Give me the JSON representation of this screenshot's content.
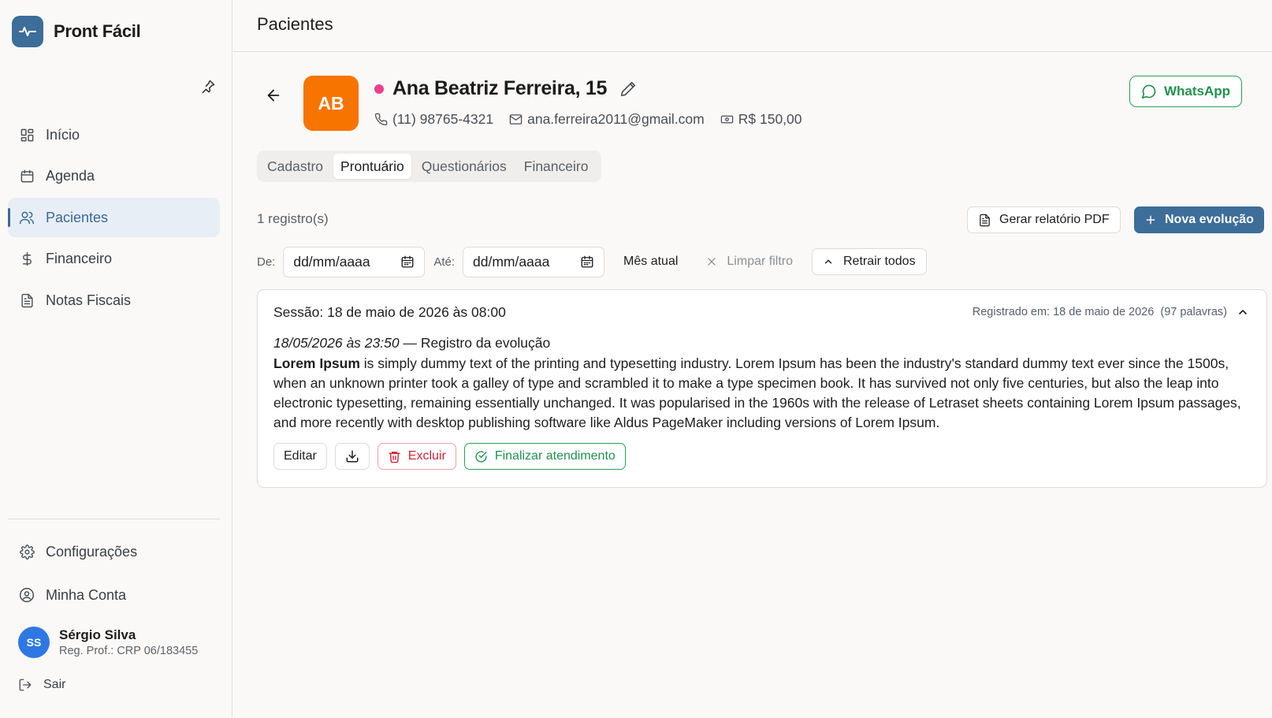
{
  "app": {
    "name": "Pront Fácil"
  },
  "sidebar": {
    "items": [
      {
        "label": "Início",
        "icon": "grid-icon"
      },
      {
        "label": "Agenda",
        "icon": "calendar-icon"
      },
      {
        "label": "Pacientes",
        "icon": "users-icon",
        "active": true
      },
      {
        "label": "Financeiro",
        "icon": "dollar-icon"
      },
      {
        "label": "Notas Fiscais",
        "icon": "file-text-icon"
      }
    ],
    "bottom_items": [
      {
        "label": "Configurações",
        "icon": "gear-icon"
      },
      {
        "label": "Minha Conta",
        "icon": "user-circle-icon"
      }
    ],
    "user": {
      "initials": "SS",
      "name": "Sérgio Silva",
      "reg": "Reg. Prof.: CRP 06/183455"
    },
    "logout_label": "Sair"
  },
  "header": {
    "title": "Pacientes"
  },
  "patient": {
    "initials": "AB",
    "name": "Ana Beatriz Ferreira, 15",
    "phone": "(11) 98765-4321",
    "email": "ana.ferreira2011@gmail.com",
    "fee": "R$ 150,00",
    "whatsapp_label": "WhatsApp",
    "status_color": "#ec3f8e",
    "avatar_color": "#f77400"
  },
  "tabs": [
    {
      "label": "Cadastro"
    },
    {
      "label": "Prontuário",
      "active": true
    },
    {
      "label": "Questionários"
    },
    {
      "label": "Financeiro"
    }
  ],
  "records": {
    "count_label": "1 registro(s)",
    "pdf_label": "Gerar relatório PDF",
    "new_label": "Nova evolução"
  },
  "filters": {
    "from_label": "De:",
    "to_label": "Até:",
    "from_placeholder": "dd/mm/aaaa",
    "to_placeholder": "dd/mm/aaaa",
    "current_month_label": "Mês atual",
    "clear_label": "Limpar filtro",
    "collapse_all_label": "Retrair todos"
  },
  "session": {
    "title": "Sessão: 18 de maio de 2026 às 08:00",
    "registered": "Registrado em: 18 de maio de 2026",
    "words": "(97 palavras)",
    "entry_timestamp": "18/05/2026 às 23:50",
    "entry_heading": " — Registro da evolução",
    "body_bold": "Lorem Ipsum",
    "body_text": " is simply dummy text of the printing and typesetting industry. Lorem Ipsum has been the industry's standard dummy text ever since the 1500s, when an unknown printer took a galley of type and scrambled it to make a type specimen book. It has survived not only five centuries, but also the leap into electronic typesetting, remaining essentially unchanged. It was popularised in the 1960s with the release of Letraset sheets containing Lorem Ipsum passages, and more recently with desktop publishing software like Aldus PageMaker including versions of Lorem Ipsum.",
    "edit_label": "Editar",
    "delete_label": "Excluir",
    "finish_label": "Finalizar atendimento"
  },
  "colors": {
    "primary": "#3d6d99",
    "whatsapp": "#23914f",
    "danger": "#d32433"
  }
}
